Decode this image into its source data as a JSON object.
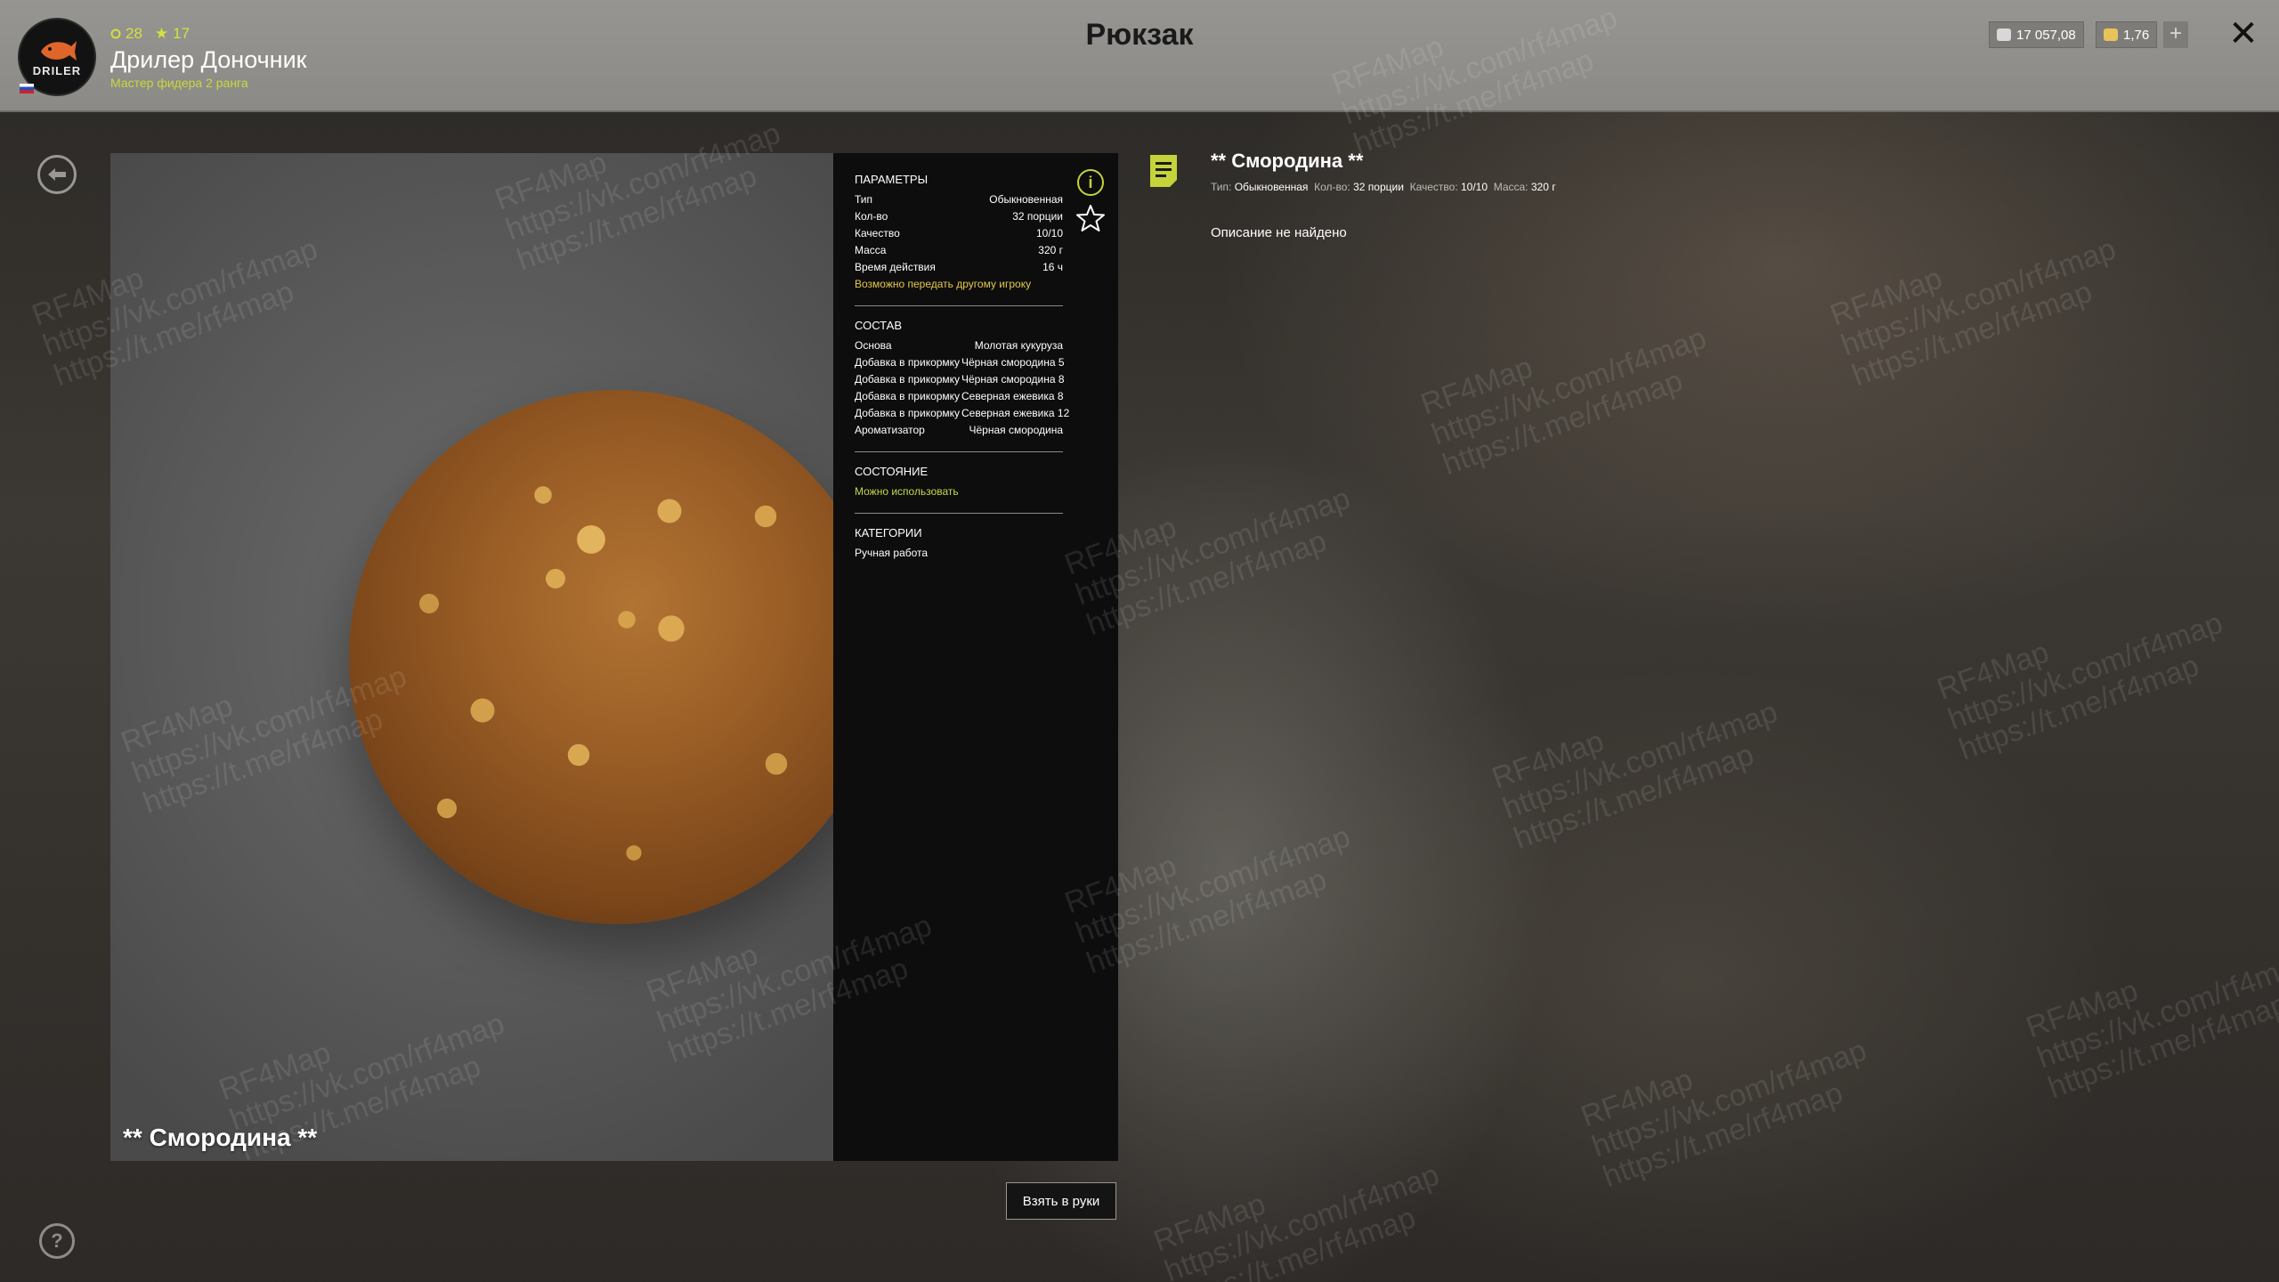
{
  "header": {
    "title": "Рюкзак",
    "player_name": "Дрилер Доночник",
    "player_rank": "Мастер фидера 2 ранга",
    "level": "28",
    "stars": "17",
    "avatar_text": "DRILER",
    "silver": "17 057,08",
    "gold": "1,76",
    "add_label": "+",
    "close_label": "✕"
  },
  "preview": {
    "item_name": "** Смородина **"
  },
  "details": {
    "params_heading": "ПАРАМЕТРЫ",
    "params": [
      {
        "k": "Тип",
        "v": "Обыкновенная"
      },
      {
        "k": "Кол-во",
        "v": "32 порции"
      },
      {
        "k": "Качество",
        "v": "10/10"
      },
      {
        "k": "Масса",
        "v": "320 г"
      },
      {
        "k": "Время действия",
        "v": "16 ч"
      }
    ],
    "transfer_note": "Возможно передать другому игроку",
    "composition_heading": "СОСТАВ",
    "composition": [
      {
        "k": "Основа",
        "v": "Молотая кукуруза"
      },
      {
        "k": "Добавка в прикормку",
        "v": "Чёрная смородина 5"
      },
      {
        "k": "Добавка в прикормку",
        "v": "Чёрная смородина 8"
      },
      {
        "k": "Добавка в прикормку",
        "v": "Северная ежевика 8"
      },
      {
        "k": "Добавка в прикормку",
        "v": "Северная ежевика 12"
      },
      {
        "k": "Ароматизатор",
        "v": "Чёрная смородина"
      }
    ],
    "state_heading": "СОСТОЯНИЕ",
    "state_value": "Можно использовать",
    "categories_heading": "КАТЕГОРИИ",
    "category_value": "Ручная работа"
  },
  "actions": {
    "take_label": "Взять в руки"
  },
  "description": {
    "title": "** Смородина **",
    "meta": [
      {
        "k": "Тип:",
        "v": "Обыкновенная"
      },
      {
        "k": "Кол-во:",
        "v": "32 порции"
      },
      {
        "k": "Качество:",
        "v": "10/10"
      },
      {
        "k": "Масса:",
        "v": "320 г"
      }
    ],
    "text": "Описание не найдено"
  },
  "watermark": {
    "text": "RF4Map\nhttps://vk.com/rf4map\nhttps://t.me/rf4map"
  },
  "colors": {
    "accent_green": "#c4d33a",
    "accent_yellow": "#e5c84a",
    "topbar": "#8f8e8a"
  }
}
